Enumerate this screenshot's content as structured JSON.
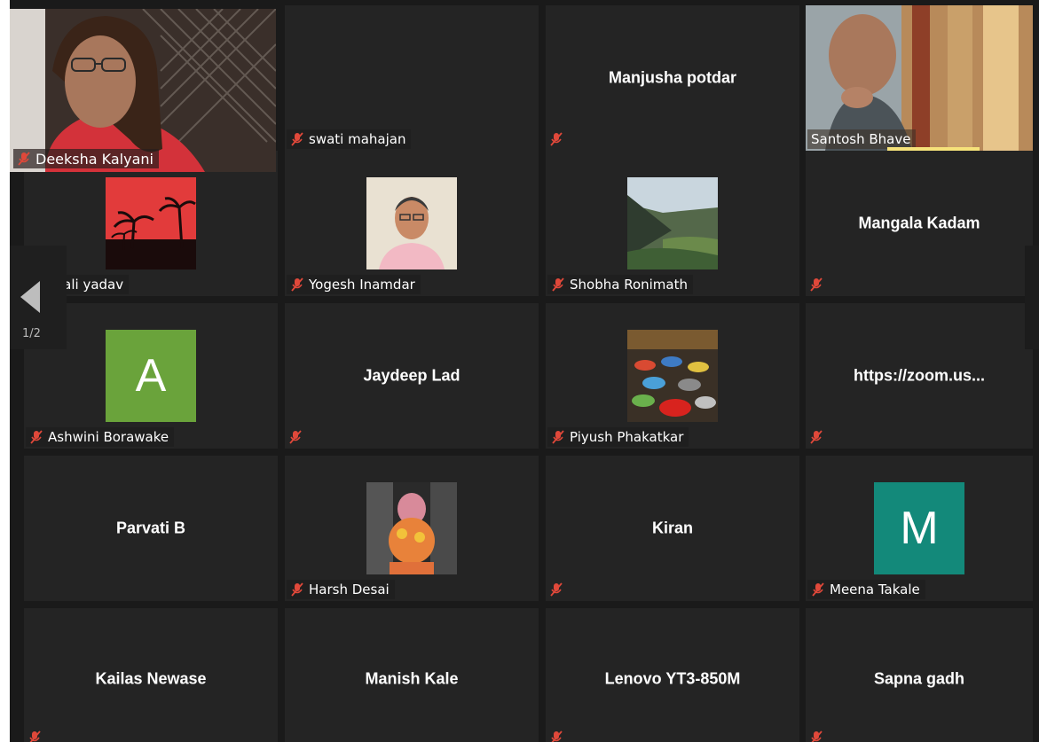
{
  "meeting": {
    "page_indicator": "1/2",
    "self_view": {
      "name": "Deeksha Kalyani"
    },
    "participants": [
      {
        "name": "swati mahajan",
        "label": "swati mahajan",
        "display": "none"
      },
      {
        "name": "Manjusha potdar",
        "label": "",
        "display": "name"
      },
      {
        "name": "Santosh Bhave",
        "label": "Santosh Bhave",
        "display": "video"
      },
      {
        "name": "jali yadav",
        "label": "jali yadav",
        "display": "image"
      },
      {
        "name": "Yogesh Inamdar",
        "label": "Yogesh Inamdar",
        "display": "image"
      },
      {
        "name": "Shobha Ronimath",
        "label": "Shobha Ronimath",
        "display": "image"
      },
      {
        "name": "Mangala Kadam",
        "label": "",
        "display": "name"
      },
      {
        "name": "Ashwini Borawake",
        "label": "Ashwini Borawake",
        "display": "letter",
        "letter": "A",
        "color": "#6aa33b"
      },
      {
        "name": "Jaydeep Lad",
        "label": "",
        "display": "name"
      },
      {
        "name": "Piyush Phakatkar",
        "label": "Piyush Phakatkar",
        "display": "image"
      },
      {
        "name": "https://zoom.us...",
        "label": "",
        "display": "name"
      },
      {
        "name": "Parvati B",
        "label": "",
        "display": "name"
      },
      {
        "name": "Harsh Desai",
        "label": "Harsh Desai",
        "display": "image"
      },
      {
        "name": "Kiran",
        "label": "",
        "display": "name"
      },
      {
        "name": "Meena Takale",
        "label": "Meena Takale",
        "display": "letter",
        "letter": "M",
        "color": "#13897a"
      },
      {
        "name": "Kailas Newase",
        "label": "",
        "display": "name"
      },
      {
        "name": "Manish Kale",
        "label": "",
        "display": "name"
      },
      {
        "name": "Lenovo YT3-850M",
        "label": "",
        "display": "name"
      },
      {
        "name": "Sapna gadh",
        "label": "",
        "display": "name"
      }
    ]
  },
  "icons": {
    "muted": "muted-mic-icon",
    "prev_page": "chevron-left-icon"
  },
  "colors": {
    "muted_red": "#e0483a",
    "active_speaker": "#f6e27a",
    "tile_bg": "#242424"
  }
}
